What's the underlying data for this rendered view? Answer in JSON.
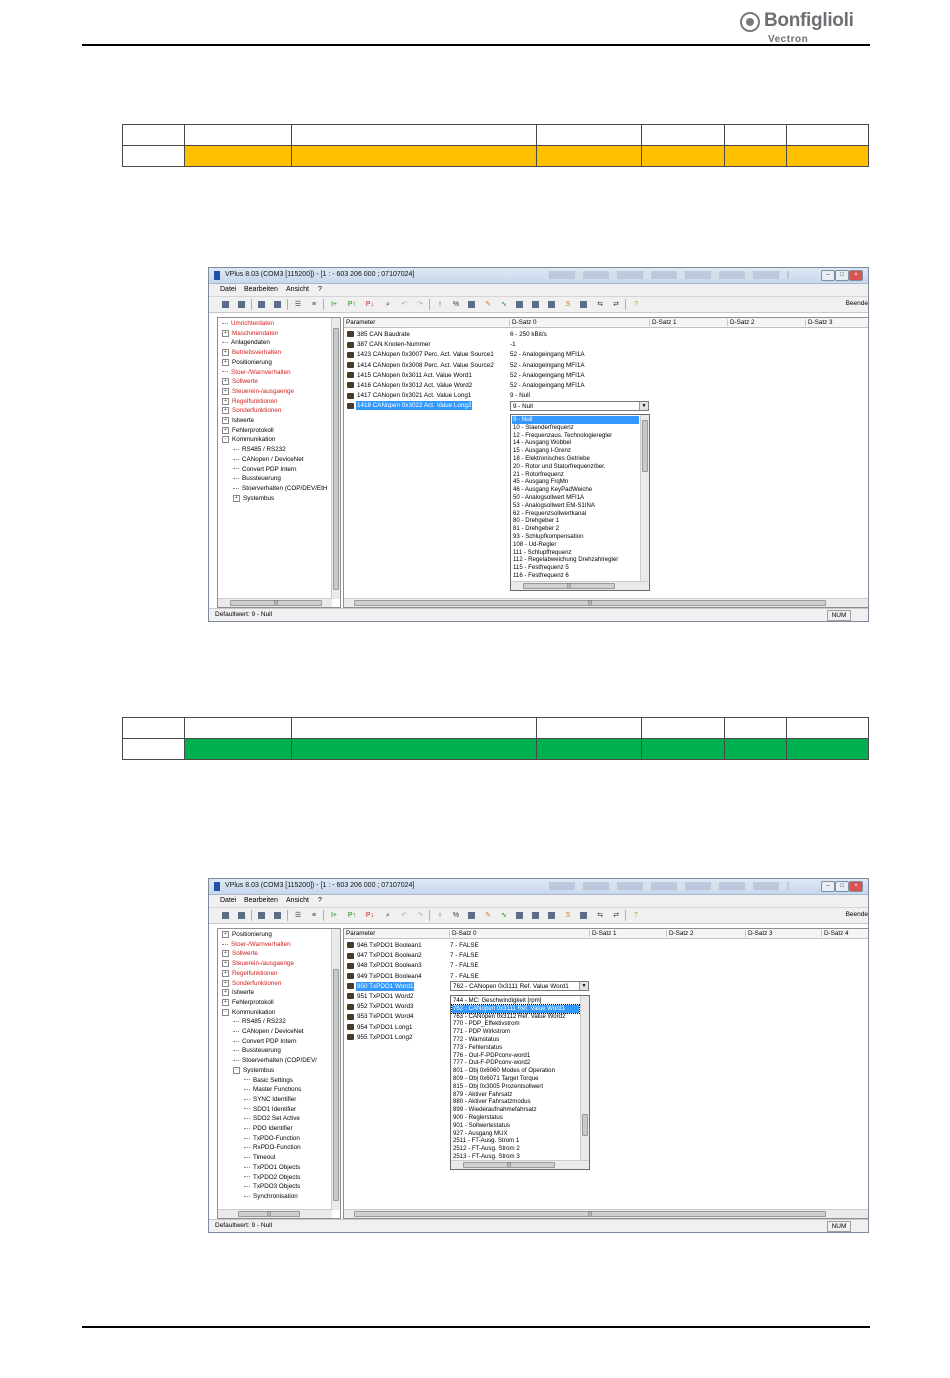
{
  "logo": {
    "brand": "Bonfiglioli",
    "sub": "Vectron"
  },
  "colors": {
    "orange_row": "#ffc000",
    "green_row": "#00b050",
    "selection": "#3399ff",
    "red_tree_item": "#d42020"
  },
  "window1": {
    "title": "VPlus 8.03 (COM3 [115200]) - [1 : -   603 206 000 ; 07107024]",
    "menu": [
      "Datei",
      "Bearbeiten",
      "Ansicht",
      "?"
    ],
    "toolbar_right": "Beende",
    "tree": [
      {
        "label": "Umrichterdaten",
        "red": true,
        "exp": ""
      },
      {
        "label": "Maschinendaten",
        "red": true,
        "exp": "+"
      },
      {
        "label": "Anlagendaten",
        "red": false,
        "exp": ""
      },
      {
        "label": "Betriebsverhalten",
        "red": true,
        "exp": "+"
      },
      {
        "label": "Positionierung",
        "red": false,
        "exp": "+"
      },
      {
        "label": "Stoer-/Warnverhalten",
        "red": true,
        "exp": ""
      },
      {
        "label": "Sollwerte",
        "red": true,
        "exp": "+"
      },
      {
        "label": "Steuerein-/ausgaenge",
        "red": true,
        "exp": "+"
      },
      {
        "label": "Regelfunktionen",
        "red": true,
        "exp": "+"
      },
      {
        "label": "Sonderfunktionen",
        "red": true,
        "exp": "+"
      },
      {
        "label": "Istwerte",
        "red": false,
        "exp": "+"
      },
      {
        "label": "Fehlerprotokoll",
        "red": false,
        "exp": "+"
      },
      {
        "label": "Kommunikation",
        "red": false,
        "exp": "-"
      },
      {
        "label": "RS485 / RS232",
        "red": false,
        "exp": "",
        "indent": 1
      },
      {
        "label": "CANopen / DeviceNet",
        "red": false,
        "exp": "",
        "indent": 1
      },
      {
        "label": "Convert PDP Intern",
        "red": false,
        "exp": "",
        "indent": 1
      },
      {
        "label": "Bussteuerung",
        "red": false,
        "exp": "",
        "indent": 1
      },
      {
        "label": "Stoerverhalten (COP/DEV/EtH",
        "red": false,
        "exp": "",
        "indent": 1
      },
      {
        "label": "Systembus",
        "red": false,
        "exp": "+",
        "indent": 1
      }
    ],
    "headers": [
      "Parameter",
      "D-Satz 0",
      "D-Satz 1",
      "D-Satz 2",
      "D-Satz 3"
    ],
    "params": [
      {
        "name": "385  CAN Baudrate",
        "value": "6 - 250 kBit/s"
      },
      {
        "name": "387  CAN Knoten-Nummer",
        "value": "-1"
      },
      {
        "name": "1423  CANopen 0x3007 Perc. Act. Value Source1",
        "value": "52 - Analogeingang MFI1A"
      },
      {
        "name": "1414  CANopen 0x3008 Perc. Act. Value Source2",
        "value": "52 - Analogeingang MFI1A"
      },
      {
        "name": "1415  CANopen 0x3011 Act. Value Word1",
        "value": "52 - Analogeingang MFI1A"
      },
      {
        "name": "1416  CANopen 0x3012 Act. Value Word2",
        "value": "52 - Analogeingang MFI1A"
      },
      {
        "name": "1417  CANopen 0x3021 Act. Value Long1",
        "value": "9 - Null"
      },
      {
        "name": "1418  CANopen 0x3022 Act. Value Long2",
        "value": ""
      }
    ],
    "dropdown_value": "9 - Null",
    "options": [
      "9 - Null",
      "10 - Staenderfrequenz",
      "12 - Frequenzaus. Technologieregler",
      "14 - Ausgang Wobbel",
      "15 - Ausgang I-Grenz",
      "18 - Elektronisches Getriebe",
      "20 - Rotor und Statorfrequenz/ber.",
      "21 - Rotorfrequenz",
      "45 - Ausgang FrqMn",
      "46 - Ausgang KeyPadWeiche",
      "50 - Analogsollwert MFI1A",
      "53 - Analogsollwert EM-S1INA",
      "62 - Frequenzsollwertkanal",
      "80 - Drehgeber 1",
      "81 - Drehgeber 2",
      "93 - Schlupfkompensation",
      "108 - Ud-Regler",
      "111 - Schlupffrequenz",
      "112 - Regelabweichung Drehzahlregler",
      "115 - Festfrequenz 5",
      "116 - Festfrequenz 6"
    ],
    "status": "Defaultwert: 9 - Null",
    "num": "NUM"
  },
  "window2": {
    "title": "VPlus 8.03 (COM3 [115200]) - [1 : -   603 206 000 ; 07107024]",
    "menu": [
      "Datei",
      "Bearbeiten",
      "Ansicht",
      "?"
    ],
    "toolbar_right": "Beende",
    "tree": [
      {
        "label": "Positionierung",
        "red": false,
        "exp": "+"
      },
      {
        "label": "Stoer-/Warnverhalten",
        "red": true,
        "exp": ""
      },
      {
        "label": "Sollwerte",
        "red": true,
        "exp": "+"
      },
      {
        "label": "Steuerein-/ausgaenge",
        "red": true,
        "exp": "+"
      },
      {
        "label": "Regelfunktionen",
        "red": true,
        "exp": "+"
      },
      {
        "label": "Sonderfunktionen",
        "red": true,
        "exp": "+"
      },
      {
        "label": "Istwerte",
        "red": false,
        "exp": "+"
      },
      {
        "label": "Fehlerprotokoll",
        "red": false,
        "exp": "+"
      },
      {
        "label": "Kommunikation",
        "red": false,
        "exp": "-"
      },
      {
        "label": "RS485 / RS232",
        "red": false,
        "exp": "",
        "indent": 1
      },
      {
        "label": "CANopen / DeviceNet",
        "red": false,
        "exp": "",
        "indent": 1
      },
      {
        "label": "Convert PDP Intern",
        "red": false,
        "exp": "",
        "indent": 1
      },
      {
        "label": "Bussteuerung",
        "red": false,
        "exp": "",
        "indent": 1
      },
      {
        "label": "Stoerverhalten (COP/DEV/",
        "red": false,
        "exp": "",
        "indent": 1
      },
      {
        "label": "Systembus",
        "red": false,
        "exp": "-",
        "indent": 1
      },
      {
        "label": "Basic Settings",
        "red": false,
        "exp": "",
        "indent": 2
      },
      {
        "label": "Master Functions",
        "red": false,
        "exp": "",
        "indent": 2
      },
      {
        "label": "SYNC Identifier",
        "red": false,
        "exp": "",
        "indent": 2
      },
      {
        "label": "SDO1 Identifier",
        "red": false,
        "exp": "",
        "indent": 2
      },
      {
        "label": "SDO2 Set Active",
        "red": false,
        "exp": "",
        "indent": 2
      },
      {
        "label": "PDO Identifier",
        "red": false,
        "exp": "",
        "indent": 2
      },
      {
        "label": "TxPDO-Function",
        "red": false,
        "exp": "",
        "indent": 2
      },
      {
        "label": "RxPDO-Function",
        "red": false,
        "exp": "",
        "indent": 2
      },
      {
        "label": "Timeout",
        "red": false,
        "exp": "",
        "indent": 2
      },
      {
        "label": "TxPDO1 Objects",
        "red": false,
        "exp": "",
        "indent": 2
      },
      {
        "label": "TxPDO2 Objects",
        "red": false,
        "exp": "",
        "indent": 2
      },
      {
        "label": "TxPDO3 Objects",
        "red": false,
        "exp": "",
        "indent": 2
      },
      {
        "label": "Synchronisation",
        "red": false,
        "exp": "",
        "indent": 2
      }
    ],
    "headers": [
      "Parameter",
      "D-Satz 0",
      "D-Satz 1",
      "D-Satz 2",
      "D-Satz 3",
      "D-Satz 4"
    ],
    "params": [
      {
        "name": "946  TxPDO1 Boolean1",
        "value": "7 - FALSE"
      },
      {
        "name": "947  TxPDO1 Boolean2",
        "value": "7 - FALSE"
      },
      {
        "name": "948  TxPDO1 Boolean3",
        "value": "7 - FALSE"
      },
      {
        "name": "949  TxPDO1 Boolean4",
        "value": "7 - FALSE"
      },
      {
        "name": "950  TxPDO1 Word1",
        "value": ""
      },
      {
        "name": "951  TxPDO1 Word2",
        "value": ""
      },
      {
        "name": "952  TxPDO1 Word3",
        "value": ""
      },
      {
        "name": "953  TxPDO1 Word4",
        "value": ""
      },
      {
        "name": "954  TxPDO1 Long1",
        "value": ""
      },
      {
        "name": "955  TxPDO1 Long2",
        "value": ""
      }
    ],
    "dropdown_value": "762 - CANopen 0x3111 Ref. Value Word1",
    "options": [
      "744 - MC: Geschwindigkeit [rpm]",
      "762 - CANopen 0x3111 Ref. Value Word1",
      "763 - CANopen 0x3112 Ref. Value Word2",
      "770 - PDP_Effektivstrom",
      "771 - PDP Wirkstrom",
      "772 - Warnstatus",
      "773 - Fehlerstatus",
      "776 - Out-F-PDPconv-word1",
      "777 - Out-F-PDPconv-word2",
      "801 - Obj 0x6060 Modes of Operation",
      "809 - Obj 0x6071 Target Torque",
      "815 - Obj 0x3005 Prozentsollwert",
      "879 - Aktiver Fahrsatz",
      "880 - Aktiver Fahrsatzmodus",
      "899 - Wiederaufnahmefahrsatz",
      "900 - Reglerstatus",
      "901 - Sollwertestatus",
      "927 - Ausgang MUX",
      "2511 - FT-Ausg. Strom 1",
      "2512 - FT-Ausg. Strom 2",
      "2513 - FT-Ausg. Strom 3"
    ],
    "status": "Defaultwert: 9 - Null",
    "num": "NUM"
  }
}
